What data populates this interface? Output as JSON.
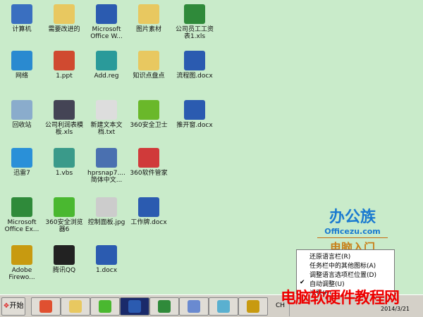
{
  "desktop_icons": [
    {
      "label": "计算机",
      "icon": "computer-icon",
      "color": "#3a6fc0"
    },
    {
      "label": "需要改进的",
      "icon": "folder-icon",
      "color": "#e8c860"
    },
    {
      "label": "Microsoft Office W...",
      "icon": "word-shortcut-icon",
      "color": "#2b5bb0"
    },
    {
      "label": "图片素材",
      "icon": "folder-icon",
      "color": "#e8c860"
    },
    {
      "label": "公司员工工资表1.xls",
      "icon": "excel-file-icon",
      "color": "#2f8a3a"
    },
    {
      "label": "网络",
      "icon": "network-icon",
      "color": "#2a8ad0"
    },
    {
      "label": "1.ppt",
      "icon": "ppt-file-icon",
      "color": "#d04a30"
    },
    {
      "label": "Add.reg",
      "icon": "registry-file-icon",
      "color": "#2a9a9a"
    },
    {
      "label": "知识点盘点",
      "icon": "folder-icon",
      "color": "#e8c860"
    },
    {
      "label": "流程图.docx",
      "icon": "word-file-icon",
      "color": "#2b5bb0"
    },
    {
      "label": "回收站",
      "icon": "recycle-bin-icon",
      "color": "#8aaccc"
    },
    {
      "label": "公司利润表模板.xls",
      "icon": "excel-file-icon",
      "color": "#445"
    },
    {
      "label": "新建文本文档.txt",
      "icon": "text-file-icon",
      "color": "#ddd"
    },
    {
      "label": "360安全卫士",
      "icon": "360-safe-icon",
      "color": "#6ab82a"
    },
    {
      "label": "推开窗.docx",
      "icon": "word-file-icon",
      "color": "#2b5bb0"
    },
    {
      "label": "迅雷7",
      "icon": "thunder-icon",
      "color": "#2a90d8"
    },
    {
      "label": "1.vbs",
      "icon": "script-file-icon",
      "color": "#3a9a8a"
    },
    {
      "label": "hprsnap7....简体中文...",
      "icon": "hypersnap-icon",
      "color": "#4a70b0"
    },
    {
      "label": "360软件管家",
      "icon": "360-software-icon",
      "color": "#d03a3a"
    },
    {
      "label": "Microsoft Office Ex...",
      "icon": "excel-shortcut-icon",
      "color": "#2f8a3a"
    },
    {
      "label": "360安全浏览器6",
      "icon": "360-browser-icon",
      "color": "#4ab830"
    },
    {
      "label": "控制面板.jpg",
      "icon": "image-file-icon",
      "color": "#ccc"
    },
    {
      "label": "工作牌.docx",
      "icon": "word-file-icon",
      "color": "#2b5bb0"
    },
    {
      "label": "Adobe Firewo...",
      "icon": "fireworks-icon",
      "color": "#c89a10"
    },
    {
      "label": "腾讯QQ",
      "icon": "qq-icon",
      "color": "#222"
    },
    {
      "label": "1.docx",
      "icon": "word-file-icon",
      "color": "#2b5bb0"
    }
  ],
  "logo": {
    "cn": "办公族",
    "en": "Officezu.com",
    "sub": "电脑入门"
  },
  "context_menu": [
    {
      "label": "还原语言栏(R)",
      "checked": false
    },
    {
      "label": "任务栏中的其他图标(A)",
      "checked": false
    },
    {
      "label": "调整语言选项栏位置(D)",
      "checked": false
    },
    {
      "label": "自动调整(U)",
      "checked": true
    },
    {
      "label": "设置(E)...",
      "checked": false
    }
  ],
  "taskbar": {
    "start_label": "开始",
    "lang": "CH",
    "date": "2014/3/21",
    "buttons": [
      {
        "icon": "360-software-icon",
        "color": "#e05030"
      },
      {
        "icon": "folder-icon",
        "color": "#e8c860"
      },
      {
        "icon": "360-browser-icon",
        "color": "#4ab830"
      },
      {
        "icon": "word-icon",
        "color": "#2b5bb0"
      },
      {
        "icon": "excel-icon",
        "color": "#2f8a3a"
      },
      {
        "icon": "word-doc-icon",
        "color": "#6a8ad0"
      },
      {
        "icon": "notepad-icon",
        "color": "#5ab0d0"
      },
      {
        "icon": "fireworks-icon",
        "color": "#c89a10"
      }
    ]
  },
  "watermark": "电脑软硬件教程网"
}
